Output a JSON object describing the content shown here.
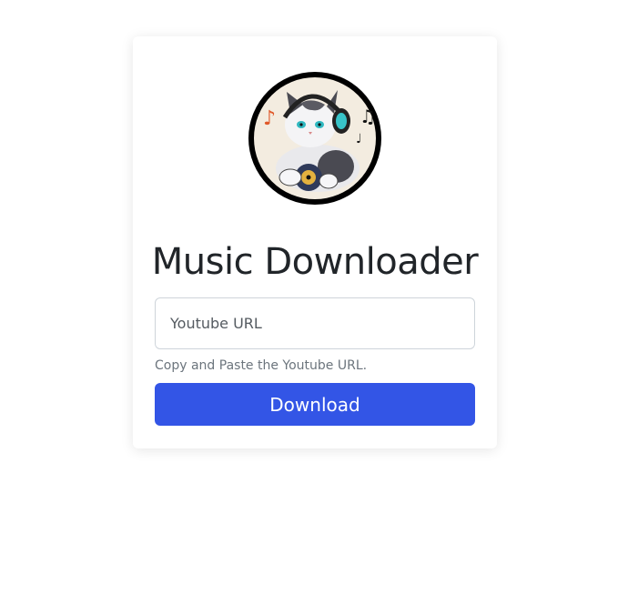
{
  "app": {
    "title": "Music Downloader"
  },
  "logo": {
    "icon": "cat-with-headphones-logo"
  },
  "form": {
    "url_placeholder": "Youtube URL",
    "url_value": "",
    "helper_text": "Copy and Paste the Youtube URL.",
    "download_label": "Download"
  },
  "colors": {
    "primary": "#3355e6",
    "title": "#212529",
    "helper": "#6c757d",
    "border": "#ced4da"
  }
}
